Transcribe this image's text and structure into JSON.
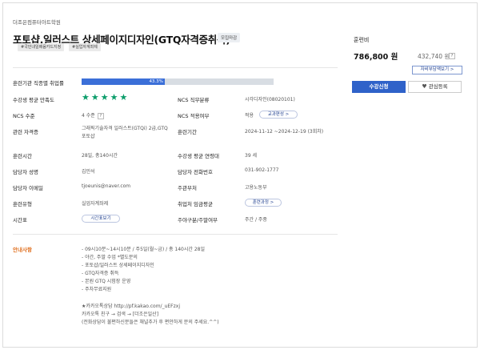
{
  "course": {
    "academy": "더조은컴퓨터아트학원",
    "title": "포토샵,일러스트 상세페이지디자인(GTQ자격증취득)",
    "status_badge": "모집마감",
    "tags": [
      "#국민내일배움카드지정",
      "#실업자계좌제"
    ]
  },
  "details": {
    "employment_rate": {
      "label": "훈련기관 직종별 취업률",
      "value_text": "43.3%",
      "percent": 43.3
    },
    "satisfaction": {
      "label": "수강생 평균 만족도",
      "stars": 5
    },
    "ncs_job_category": {
      "label": "NCS 직무분류",
      "value": "시각디자인(08020101)"
    },
    "ncs_level": {
      "label": "NCS 수준",
      "value": "4 수준",
      "help": "?"
    },
    "ncs_applied": {
      "label": "NCS 적용여부",
      "value": "적용",
      "button": "교과편성 >"
    },
    "certificate": {
      "label": "관련 자격증",
      "value": "그래픽기술자격 일러스트(GTQi) 2급,GTQ 포토샵"
    },
    "period": {
      "label": "훈련기간",
      "value": "2024-11-12 ~2024-12-19 (3회차)"
    },
    "hours": {
      "label": "훈련시간",
      "value": "28일, 총140시간"
    },
    "avg_age": {
      "label": "수강생 평균 연령대",
      "value": "39 세"
    },
    "manager": {
      "label": "담당자 성명",
      "value": "김민석"
    },
    "phone": {
      "label": "담당자 전화번호",
      "value": "031-902-1777"
    },
    "email": {
      "label": "담당자 이메일",
      "value": "tjoeunis@naver.com"
    },
    "ministry": {
      "label": "주관부처",
      "value": "고용노동부"
    },
    "training_type": {
      "label": "훈련유형",
      "value": "실업자계좌제"
    },
    "wage": {
      "label": "취업처 임금평균",
      "button": "훈련과정 >"
    },
    "schedule": {
      "label": "시간표",
      "button": "시간표보기"
    },
    "weekday": {
      "label": "주야구분/주말여부",
      "value": "주간 / 주중"
    }
  },
  "guide": {
    "title": "안내사항",
    "lines": [
      "- 09시10분~14시10분 / 주5일(월~금) / 총 140시간 28일",
      "- 야간, 주말 수업 *별도문의",
      "- 포토샵/일러스트 상세페이지디자인",
      "- GTQ자격증 취득",
      "- 본원 GTQ 시험장 운영",
      "- 주차무료지원",
      "",
      "★카카오톡상담 http://pf.kakao.com/_uEFzxj",
      "카카오톡 친구 → 검색 → [더조은일산]",
      "(전화상담이 불편하신분들은 채널추가 후 편안하게 문의 주세요.^^)"
    ]
  },
  "sidebar": {
    "fee_label": "훈련비",
    "price": "786,800 원",
    "self_pay": "432,740 원",
    "help": "?",
    "self_pay_button": "자비부담액보기 >",
    "enroll_button": "수강신청",
    "favorite_button": "관심등록",
    "favorite_icon": "heart-icon"
  },
  "colors": {
    "accent": "#2f62c9",
    "progress": "#3b6fd8",
    "stars": "#0a9d6a",
    "guide_title": "#e07020"
  }
}
